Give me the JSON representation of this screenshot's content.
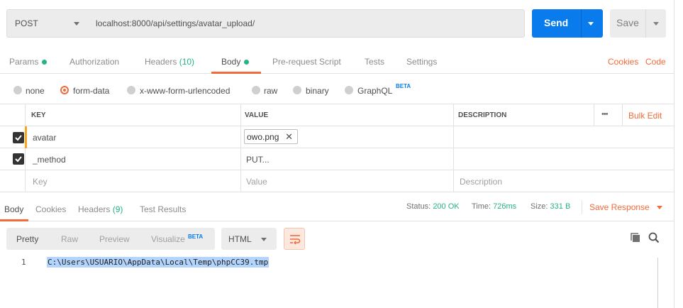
{
  "request": {
    "method": "POST",
    "url": "localhost:8000/api/settings/avatar_upload/",
    "send_label": "Send",
    "save_label": "Save"
  },
  "request_tabs": [
    {
      "label": "Params"
    },
    {
      "label": "Authorization"
    },
    {
      "label": "Headers",
      "count": "(10)"
    },
    {
      "label": "Body"
    },
    {
      "label": "Pre-request Script"
    },
    {
      "label": "Tests"
    },
    {
      "label": "Settings"
    }
  ],
  "links": {
    "cookies": "Cookies",
    "code": "Code"
  },
  "body_types": {
    "none": "none",
    "form_data": "form-data",
    "urlencoded": "x-www-form-urlencoded",
    "raw": "raw",
    "binary": "binary",
    "graphql": "GraphQL",
    "beta": "BETA",
    "selected": "form-data"
  },
  "table": {
    "headers": {
      "key": "KEY",
      "value": "VALUE",
      "description": "DESCRIPTION",
      "more": "•••",
      "bulk_edit": "Bulk Edit"
    },
    "rows": [
      {
        "key": "avatar",
        "value": "owo.png",
        "checked": true
      },
      {
        "key": "_method",
        "value": "PUT...",
        "checked": true
      }
    ],
    "placeholders": {
      "key": "Key",
      "value": "Value",
      "description": "Description"
    }
  },
  "response": {
    "tabs": [
      {
        "label": "Body"
      },
      {
        "label": "Cookies"
      },
      {
        "label": "Headers",
        "count": "(9)"
      },
      {
        "label": "Test Results"
      }
    ],
    "status_label": "Status:",
    "status_value": "200 OK",
    "time_label": "Time:",
    "time_value": "726ms",
    "size_label": "Size:",
    "size_value": "331 B",
    "save_response": "Save Response",
    "view_modes": [
      "Pretty",
      "Raw",
      "Preview",
      "Visualize"
    ],
    "visualize_beta": "BETA",
    "format": "HTML",
    "lines": [
      {
        "no": "1",
        "text": "C:\\Users\\USUARIO\\AppData\\Local\\Temp\\phpCC39.tmp"
      }
    ]
  },
  "colors": {
    "accent": "#f26b3a",
    "send": "#097bed",
    "success": "#26b47f"
  },
  "icons": [
    "chevron-down-icon",
    "close-icon",
    "checkmark-icon",
    "wrap-lines-icon",
    "copy-icon",
    "search-icon"
  ]
}
